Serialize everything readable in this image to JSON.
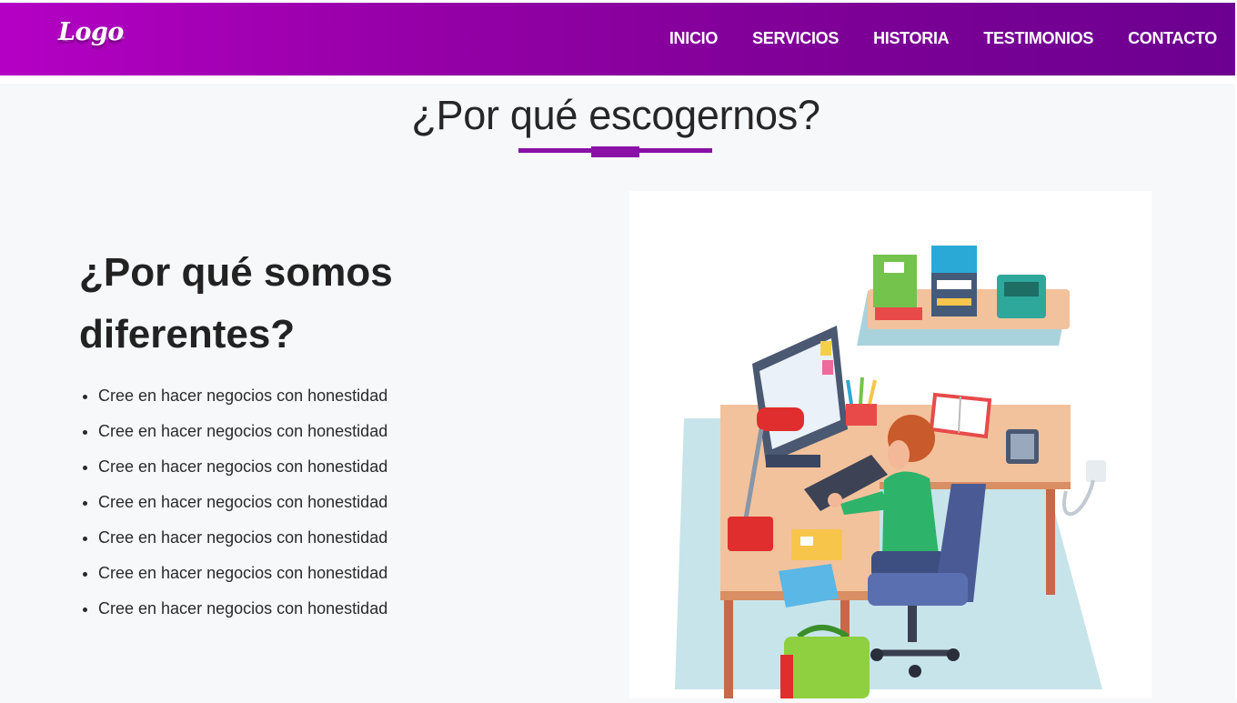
{
  "header": {
    "logo": "Logo",
    "nav": [
      "INICIO",
      "SERVICIOS",
      "HISTORIA",
      "TESTIMONIOS",
      "CONTACTO"
    ]
  },
  "section": {
    "title": "¿Por qué escogernos?",
    "heading": "¿Por qué somos diferentes?",
    "list": [
      "Cree en hacer negocios con honestidad",
      "Cree en hacer negocios con honestidad",
      "Cree en hacer negocios con honestidad",
      "Cree en hacer negocios con honestidad",
      "Cree en hacer negocios con honestidad",
      "Cree en hacer negocios con honestidad",
      "Cree en hacer negocios con honestidad"
    ]
  },
  "colors": {
    "header_start": "#b400c4",
    "header_end": "#6c0090",
    "accent": "#8a0fa6",
    "background": "#f7f8fa"
  },
  "illustration": "office-worker-desk-illustration"
}
